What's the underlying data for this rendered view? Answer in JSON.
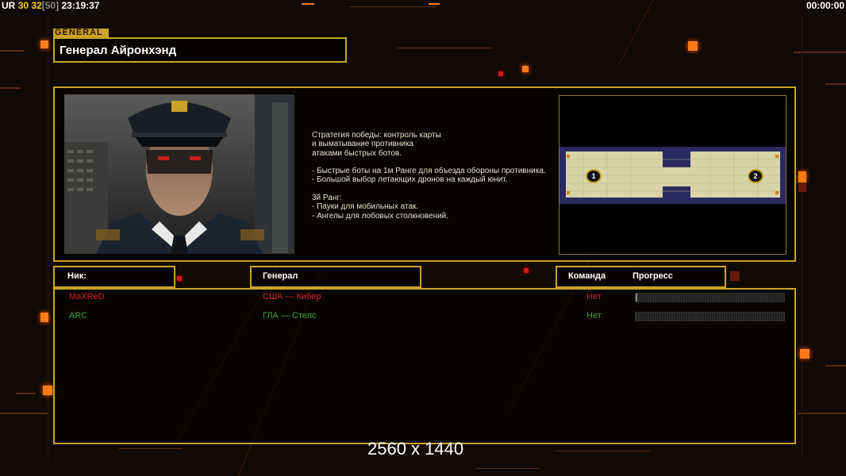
{
  "topbar": {
    "ur": "UR",
    "v1": "30",
    "v2": "32",
    "v3": "[50]",
    "clock": "23:19:37",
    "timer": "00:00:00"
  },
  "general": {
    "tag": "GENERAL",
    "name": "Генерал Айронхэнд",
    "description": "Стратегия победы: контроль карты\nи выматывание противника\nатаками быстрых ботов.\n\n- Быстрые боты на 1м Ранге для объезда обороны противника.\n- Большой выбор летающих дронов на каждый юнит.\n\n3й Ранг:\n- Пауки для мобильных атак.\n- Ангелы для лобовых столкновений."
  },
  "map": {
    "start_positions": [
      "1",
      "2"
    ]
  },
  "table": {
    "headers": {
      "nick": "Ник:",
      "general": "Генерал",
      "team": "Команда",
      "progress": "Прогресс"
    },
    "players": [
      {
        "nick": "MaXReD",
        "general": "США — Кибер",
        "team": "Нет",
        "progress": 0.01,
        "color": "#d82020"
      },
      {
        "nick": "ARC",
        "general": "ГЛА — Стелс",
        "team": "Нет",
        "progress": 0.0,
        "color": "#3aa83a"
      }
    ]
  },
  "resolution_label": "2560 x 1440",
  "colors": {
    "accent_gold": "#c9a227",
    "glow_orange": "#ff7a1a",
    "player1": "#d82020",
    "player2": "#3aa83a"
  }
}
